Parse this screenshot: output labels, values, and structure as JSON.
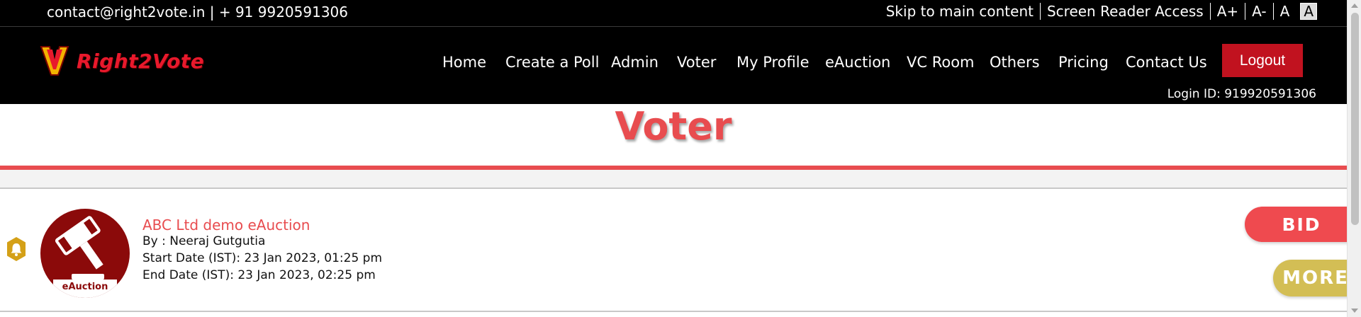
{
  "topbar": {
    "contact": "contact@right2vote.in  |  + 91 9920591306",
    "accessibility": [
      "Skip to main content",
      "Screen Reader Access",
      "A+",
      "A-",
      "A",
      "A"
    ]
  },
  "brand": {
    "name": "Right2Vote"
  },
  "nav": {
    "items": [
      "Home",
      "Create a Poll",
      "Admin",
      "Voter",
      "My Profile",
      "eAuction",
      "VC Room",
      "Others",
      "Pricing",
      "Contact Us"
    ],
    "logout": "Logout",
    "login_id": "Login ID: 919920591306"
  },
  "page": {
    "title": "Voter"
  },
  "card": {
    "title": "ABC Ltd demo eAuction",
    "by": "By : Neeraj Gutgutia",
    "start": "Start Date (IST): 23 Jan 2023, 01:25 pm",
    "end": "End Date (IST): 23 Jan 2023, 02:25 pm",
    "avatar_label": "eAuction",
    "bid": "BID",
    "more": "MORE"
  },
  "colors": {
    "accent": "#e84c4f",
    "logout": "#c1121f",
    "gold": "#d3be55",
    "avatar": "#8b0a0a"
  },
  "icons": [
    "v-logo-icon",
    "bell-icon",
    "gavel-icon"
  ]
}
